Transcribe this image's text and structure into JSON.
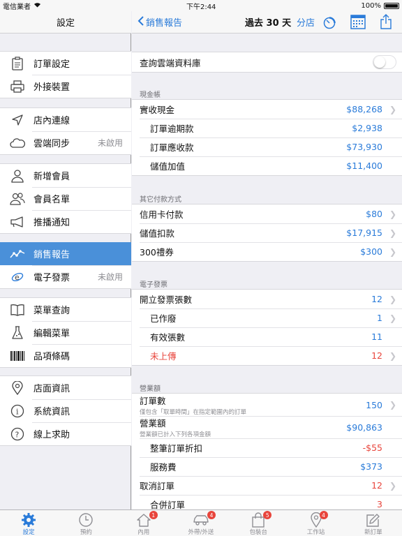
{
  "status_bar": {
    "carrier": "電信業者",
    "time": "下午2:44",
    "battery": "100%"
  },
  "left": {
    "title": "設定",
    "groups": [
      [
        {
          "label": "訂單設定",
          "icon": "clipboard-icon"
        },
        {
          "label": "外接裝置",
          "icon": "printer-icon"
        }
      ],
      [
        {
          "label": "店內連線",
          "icon": "location-arrow-icon"
        },
        {
          "label": "雲端同步",
          "icon": "cloud-icon",
          "detail": "未啟用"
        }
      ],
      [
        {
          "label": "新增會員",
          "icon": "person-icon"
        },
        {
          "label": "會員名單",
          "icon": "people-icon"
        },
        {
          "label": "推播通知",
          "icon": "megaphone-icon"
        }
      ],
      [
        {
          "label": "銷售報告",
          "icon": "chart-line-icon",
          "active": true
        },
        {
          "label": "電子發票",
          "icon": "e-invoice-icon",
          "detail": "未啟用"
        }
      ],
      [
        {
          "label": "菜單查詢",
          "icon": "menu-book-icon"
        },
        {
          "label": "編輯菜單",
          "icon": "flask-icon"
        },
        {
          "label": "品項條碼",
          "icon": "barcode-icon"
        }
      ],
      [
        {
          "label": "店面資訊",
          "icon": "map-pin-icon"
        },
        {
          "label": "系統資訊",
          "icon": "info-icon"
        },
        {
          "label": "線上求助",
          "icon": "help-icon"
        }
      ]
    ]
  },
  "right": {
    "back_label": "銷售報告",
    "title": "過去 30 天",
    "branch_label": "分店",
    "cloud_query_label": "查詢雲端資料庫",
    "cash": {
      "header": "現金帳",
      "rows": [
        {
          "label": "實收現金",
          "value": "$88,268",
          "sub": false,
          "chevron": true
        },
        {
          "label": "訂單逾期款",
          "value": "$2,938",
          "sub": true,
          "chevron": false
        },
        {
          "label": "訂單應收款",
          "value": "$73,930",
          "sub": true,
          "chevron": false
        },
        {
          "label": "儲值加值",
          "value": "$11,400",
          "sub": true,
          "chevron": false
        }
      ]
    },
    "other_payment": {
      "header": "其它付款方式",
      "rows": [
        {
          "label": "信用卡付款",
          "value": "$80",
          "chevron": true
        },
        {
          "label": "儲值扣款",
          "value": "$17,915",
          "chevron": true
        },
        {
          "label": "300禮券",
          "value": "$300",
          "chevron": true
        }
      ]
    },
    "einvoice": {
      "header": "電子發票",
      "rows": [
        {
          "label": "開立發票張數",
          "value": "12",
          "sub": false,
          "chevron": true,
          "red": false
        },
        {
          "label": "已作廢",
          "value": "1",
          "sub": true,
          "chevron": true,
          "red": false
        },
        {
          "label": "有效張數",
          "value": "11",
          "sub": true,
          "chevron": false,
          "red": false
        },
        {
          "label": "未上傳",
          "value": "12",
          "sub": true,
          "chevron": true,
          "red": true
        }
      ]
    },
    "revenue": {
      "header": "營業額",
      "order_count_label": "訂單數",
      "order_count_note": "僅包含「取單時間」在指定範圍內的訂單",
      "order_count_value": "150",
      "revenue_label": "營業額",
      "revenue_note": "營業額已計入下列各項金額",
      "revenue_value": "$90,863",
      "discount_label": "整筆訂單折扣",
      "discount_value": "-$55",
      "service_label": "服務費",
      "service_value": "$373",
      "cancel_label": "取消訂單",
      "cancel_value": "12",
      "merge_label": "合併訂單",
      "merge_value": "3"
    }
  },
  "tabbar": [
    {
      "label": "設定",
      "icon": "gear-icon",
      "active": true,
      "badge": ""
    },
    {
      "label": "預約",
      "icon": "clock-icon",
      "active": false,
      "badge": ""
    },
    {
      "label": "內用",
      "icon": "house-icon",
      "active": false,
      "badge": "1"
    },
    {
      "label": "外帶/外送",
      "icon": "car-icon",
      "active": false,
      "badge": "4"
    },
    {
      "label": "包裝台",
      "icon": "bag-icon",
      "active": false,
      "badge": "5"
    },
    {
      "label": "工作站",
      "icon": "pin-icon",
      "active": false,
      "badge": "4"
    },
    {
      "label": "新訂單",
      "icon": "compose-icon",
      "active": false,
      "badge": ""
    }
  ]
}
